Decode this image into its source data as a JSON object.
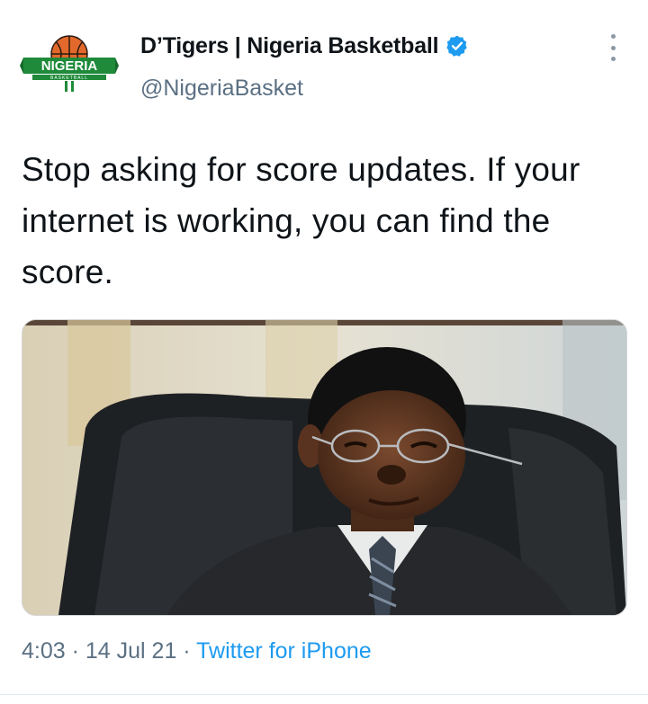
{
  "author": {
    "display_name": "D’Tigers | Nigeria Basketball",
    "handle": "@NigeriaBasket",
    "verified_icon": "verified-badge-icon",
    "avatar_text": "NIGERIA",
    "avatar_subtext": "BASKETBALL"
  },
  "tweet": {
    "text": "Stop asking for score updates. If your internet is working, you can find the score."
  },
  "meta": {
    "time": "4:03",
    "separator1": " · ",
    "date": "14 Jul 21",
    "separator2": " · ",
    "source": "Twitter for iPhone"
  },
  "colors": {
    "accent": "#1d9bf0",
    "secondary_text": "#5b7083",
    "primary_text": "#0f1419"
  }
}
